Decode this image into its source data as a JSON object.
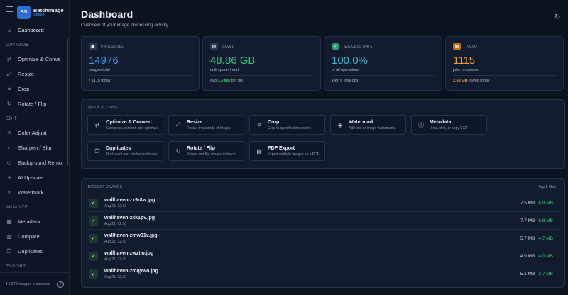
{
  "app": {
    "badge": "BS",
    "name": "BatchImage",
    "subtitle": "Studio"
  },
  "sidebar": {
    "dashboard": "Dashboard",
    "sections": {
      "optimize": "OPTIMIZE",
      "edit": "EDIT",
      "analyze": "ANALYZE",
      "export": "EXPORT"
    },
    "optimize_items": [
      "Optimize & Conve",
      "Resize",
      "Crop",
      "Rotate / Flip"
    ],
    "edit_items": [
      "Color Adjust",
      "Sharpen / Blur",
      "Background Remo",
      "AI Upscale",
      "Watermark"
    ],
    "analyze_items": [
      "Metadata",
      "Compare",
      "Duplicates"
    ],
    "footer": "14,976 images processed"
  },
  "header": {
    "title": "Dashboard",
    "subtitle": "Overview of your image processing activity"
  },
  "stats": [
    {
      "label": "PROCESSED",
      "value": "14976",
      "desc": "images total",
      "foot_prefix": "↑ 1115 today",
      "foot_highlight": "",
      "foot_suffix": "",
      "color": "#3b9cf5",
      "icon": "image-icon"
    },
    {
      "label": "SAVED",
      "value": "48.86 GB",
      "desc": "disk space freed",
      "foot_prefix": "avg ",
      "foot_highlight": "3.3 MB",
      "foot_suffix": " per file",
      "color": "#36c27a",
      "icon": "save-icon"
    },
    {
      "label": "SUCCESS RATE",
      "value": "100.0%",
      "desc": "of all operations",
      "foot_prefix": "14976 total ops",
      "foot_highlight": "",
      "foot_suffix": "",
      "color": "#3fb6d8",
      "icon": "check-badge-icon"
    },
    {
      "label": "TODAY",
      "value": "1115",
      "desc": "jobs processed",
      "foot_prefix": "",
      "foot_highlight": "2.60 GB",
      "foot_suffix": " saved today",
      "color": "#f0a030",
      "icon": "calendar-icon"
    }
  ],
  "quick_actions": {
    "title": "QUICK ACTIONS",
    "items": [
      {
        "title": "Optimize & Convert",
        "desc": "Compress, convert, and optimize"
      },
      {
        "title": "Resize",
        "desc": "Resize thousands of images"
      },
      {
        "title": "Crop",
        "desc": "Crop to specific dimensions"
      },
      {
        "title": "Watermark",
        "desc": "Add text or image watermarks"
      },
      {
        "title": "Metadata",
        "desc": "View, strip, or copy EXIF"
      },
      {
        "title": "Duplicates",
        "desc": "Find exact and similar duplicates"
      },
      {
        "title": "Rotate / Flip",
        "desc": "Rotate and flip images in batch"
      },
      {
        "title": "PDF Export",
        "desc": "Export multiple images as a PDF"
      }
    ]
  },
  "savings": {
    "title": "BIGGEST SAVINGS",
    "count": "Top 5 files",
    "rows": [
      {
        "name": "wallhaven-zx9r8w.jpg",
        "date": "Aug 21, 22:30",
        "orig": "7.5 MB",
        "new": "6.9 MB"
      },
      {
        "name": "wallhaven-zxk1pv.jpg",
        "date": "Aug 21, 22:30",
        "orig": "7.7 MB",
        "new": "6.8 MB"
      },
      {
        "name": "wallhaven-zmw31v.jpg",
        "date": "Aug 21, 22:30",
        "orig": "5.7 MB",
        "new": "4.7 MB"
      },
      {
        "name": "wallhaven-zwztio.jpg",
        "date": "Aug 21, 22:30",
        "orig": "4.9 MB",
        "new": "4.0 MB"
      },
      {
        "name": "wallhaven-zmqywo.jpg",
        "date": "Aug 21, 22:30",
        "orig": "5.1 MB",
        "new": "3.7 MB"
      }
    ]
  }
}
